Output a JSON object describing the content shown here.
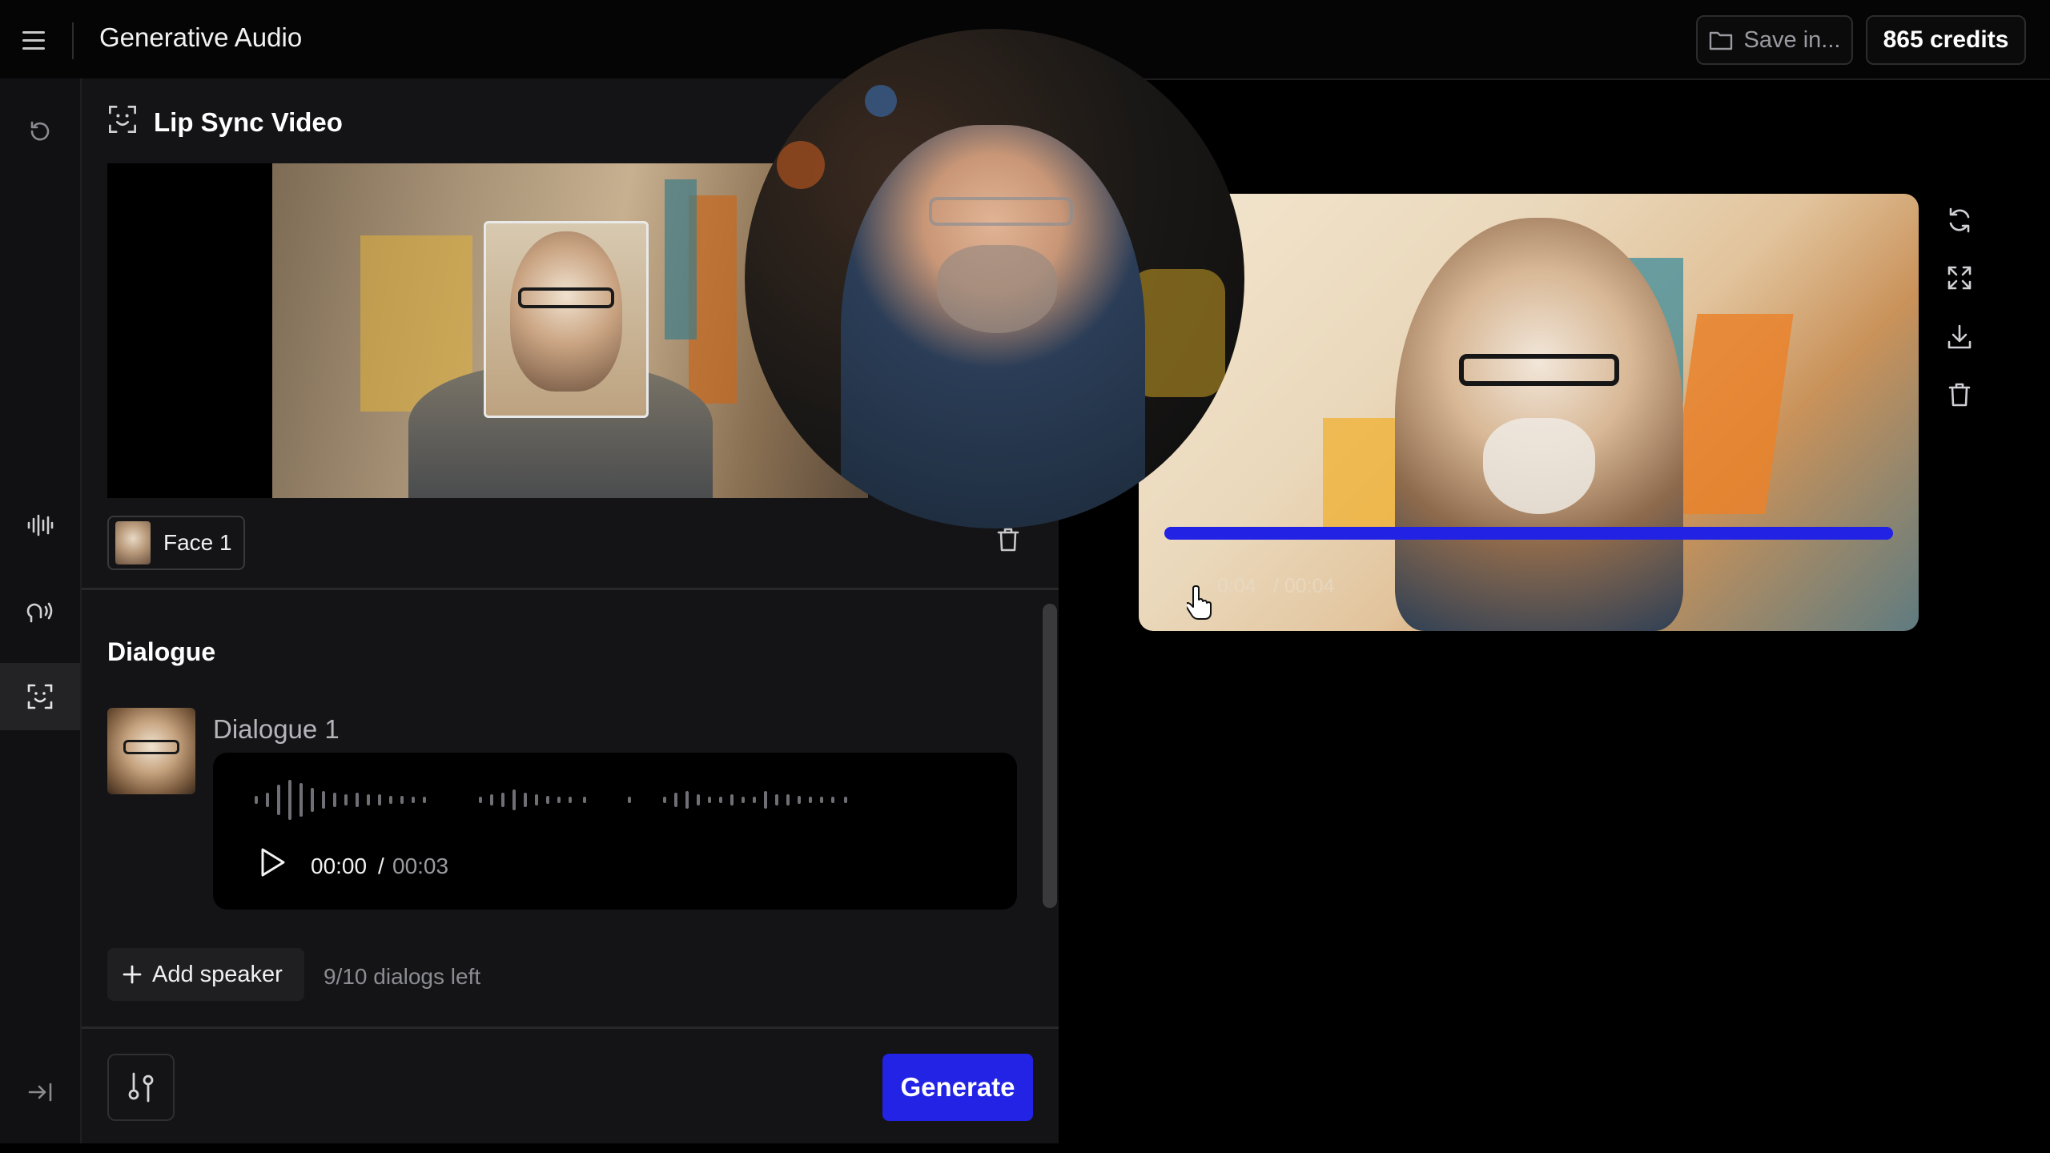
{
  "header": {
    "menu_icon": "hamburger-menu-icon",
    "app_title": "Generative Audio",
    "save_label": "Save in...",
    "credits_label": "865 credits"
  },
  "rail": {
    "items": [
      {
        "icon": "history-icon"
      },
      {
        "icon": "waveform-icon"
      },
      {
        "icon": "voice-icon"
      },
      {
        "icon": "face-scan-icon",
        "active": true
      },
      {
        "icon": "collapse-sidebar-icon"
      }
    ]
  },
  "panel": {
    "title": "Lip Sync Video",
    "face_chip_label": "Face 1",
    "dialogue_heading": "Dialogue",
    "dialogue": {
      "name": "Dialogue 1",
      "time_current": "00:00",
      "time_separator": "/",
      "time_total": "00:03"
    },
    "add_speaker_label": "Add speaker",
    "dialogs_left": "9/10 dialogs left",
    "generate_label": "Generate"
  },
  "result": {
    "time_current": "0:04",
    "time_total": "/ 00:04",
    "progress": 1.0,
    "tools": [
      "regenerate-icon",
      "fullscreen-icon",
      "download-icon",
      "trash-icon"
    ]
  },
  "colors": {
    "accent": "#2323e6",
    "background": "#000000",
    "panel": "#141416"
  }
}
